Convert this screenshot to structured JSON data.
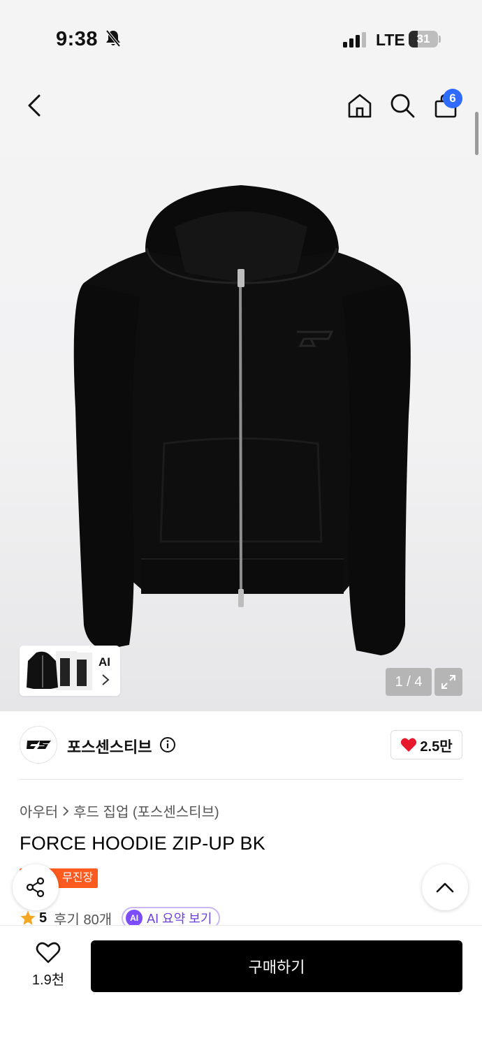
{
  "status_bar": {
    "time": "9:38",
    "network": "LTE",
    "battery": "31",
    "battery_level": 0.31
  },
  "nav": {
    "cart_count": "6"
  },
  "gallery": {
    "ai_label": "AI",
    "counter": "1 / 4"
  },
  "brand": {
    "name": "포스센스티브",
    "likes": "2.5만"
  },
  "breadcrumb": {
    "category": "아우터",
    "subcategory": "후드 집업 (포스센스티브)"
  },
  "product": {
    "title": "FORCE HOODIE ZIP-UP BK",
    "tag": "무진장",
    "rating": "5",
    "reviews": "후기 80개",
    "ai_summary": "AI 요약 보기",
    "ai_badge": "AI"
  },
  "bottom": {
    "wish_count": "1.9천",
    "buy_label": "구매하기"
  },
  "colors": {
    "buy_button": "#000000",
    "cart_badge": "#2f6bff",
    "tag": "#ff5a1f",
    "heart": "#e8182d",
    "ai_accent": "#7b4dff",
    "star": "#f5a623"
  }
}
